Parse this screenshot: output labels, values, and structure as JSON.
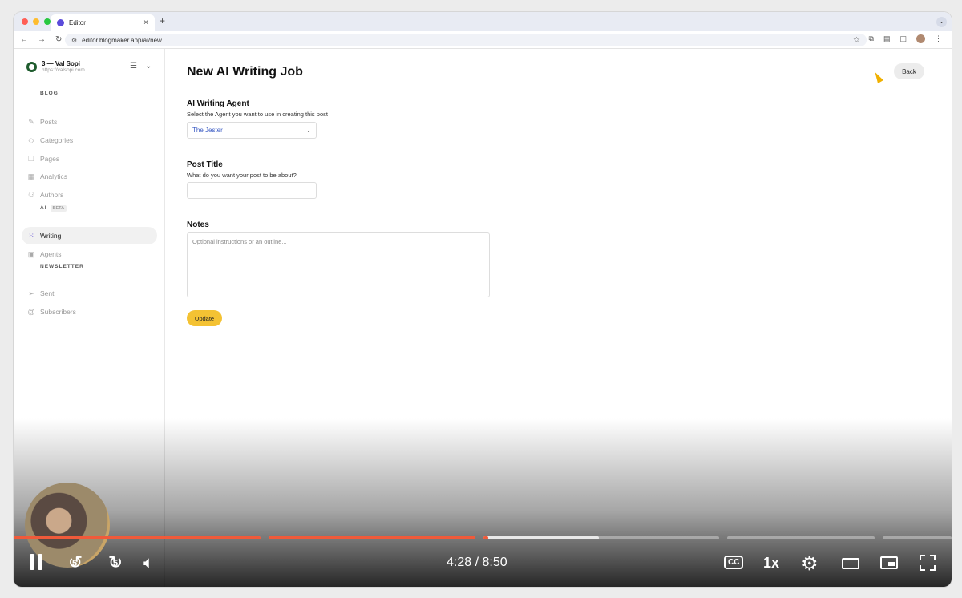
{
  "browser": {
    "tab_title": "Editor",
    "tab_close": "×",
    "new_tab": "+",
    "url": "editor.blogmaker.app/ai/new",
    "traffic_colors": [
      "#ff5f57",
      "#febc2e",
      "#28c840"
    ]
  },
  "sidebar": {
    "account_name": "3 — Val Sopi",
    "account_url": "https://valsopi.com",
    "sections": {
      "blog": "BLOG",
      "ai": "AI",
      "ai_badge": "BETA",
      "newsletter": "NEWSLETTER"
    },
    "items": [
      {
        "label": "Posts",
        "icon": "edit-icon"
      },
      {
        "label": "Categories",
        "icon": "tag-icon"
      },
      {
        "label": "Pages",
        "icon": "pages-icon"
      },
      {
        "label": "Analytics",
        "icon": "chart-icon"
      },
      {
        "label": "Authors",
        "icon": "users-icon"
      },
      {
        "label": "Writing",
        "icon": "sparkle-icon",
        "active": true
      },
      {
        "label": "Agents",
        "icon": "cpu-icon"
      },
      {
        "label": "Sent",
        "icon": "send-icon"
      },
      {
        "label": "Subscribers",
        "icon": "at-icon"
      }
    ]
  },
  "main": {
    "title": "New AI Writing Job",
    "back_label": "Back",
    "agent": {
      "label": "AI Writing Agent",
      "help": "Select the Agent you want to use in creating this post",
      "selected": "The Jester"
    },
    "post_title": {
      "label": "Post Title",
      "help": "What do you want your post to be about?",
      "value": ""
    },
    "notes": {
      "label": "Notes",
      "placeholder": "Optional instructions or an outline..."
    },
    "update_label": "Update"
  },
  "player": {
    "time": "4:28 / 8:50",
    "speed": "1x",
    "cc": "CC",
    "skip_back": "5",
    "skip_fwd": "5",
    "accent": "#f05a3a"
  }
}
